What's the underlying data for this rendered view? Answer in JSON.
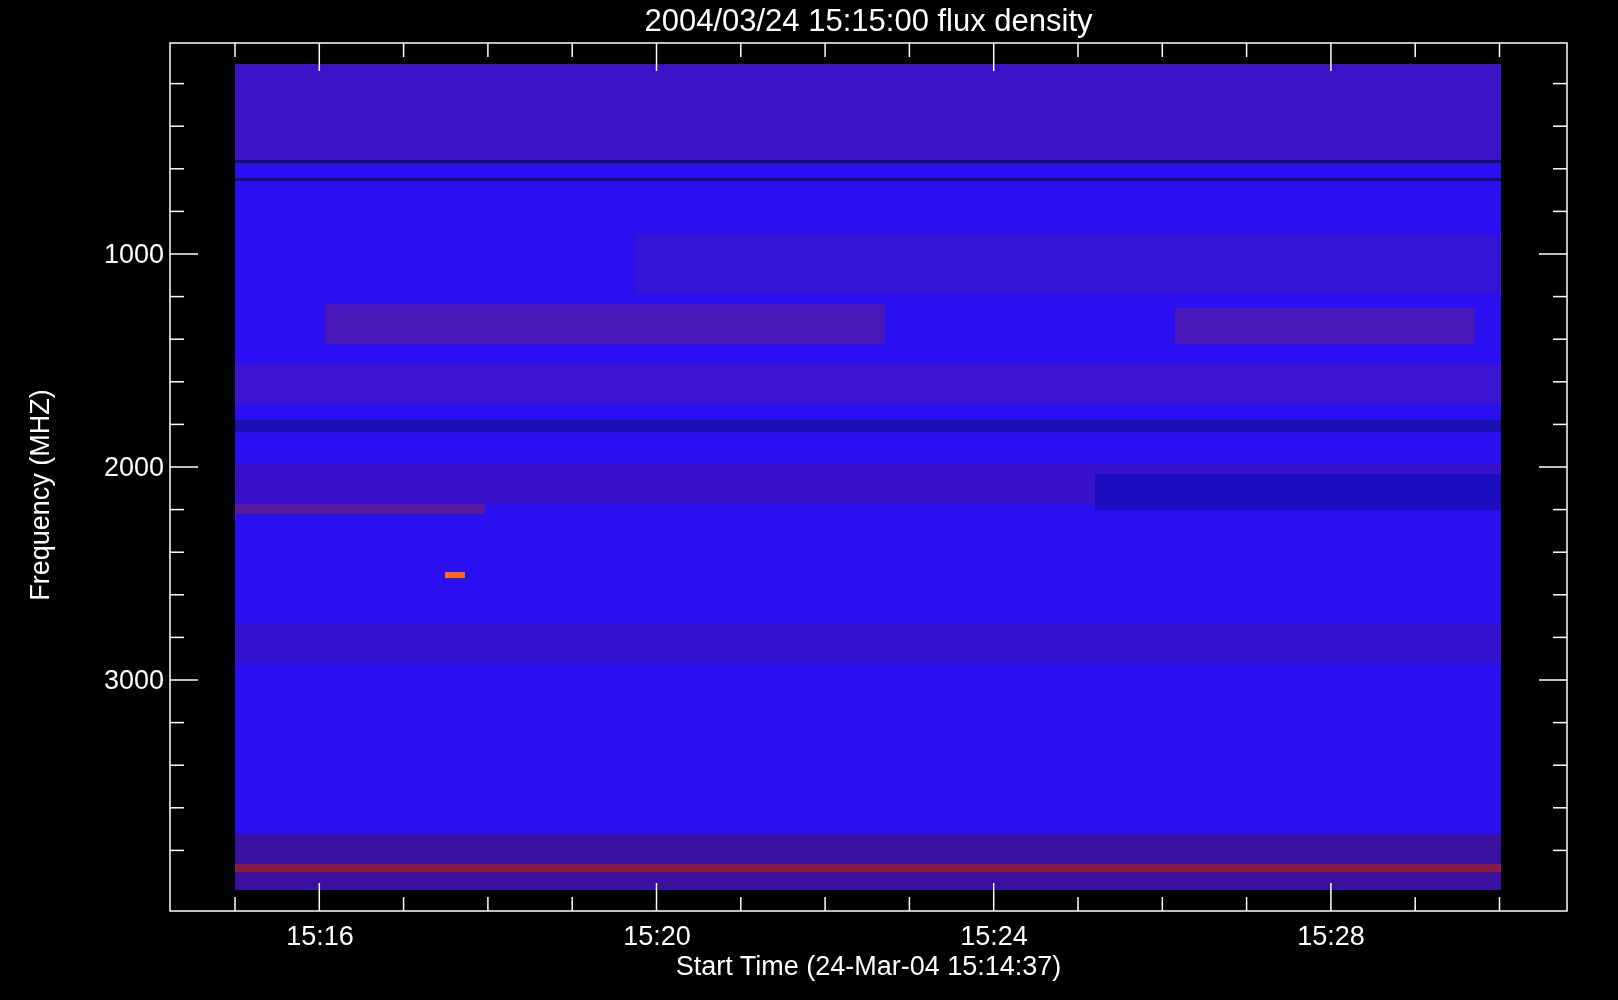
{
  "plot": {
    "title": "2004/03/24 15:15:00 flux density",
    "xlabel": "Start Time (24-Mar-04 15:14:37)",
    "ylabel": "Frequency (MHZ)",
    "xticks": [
      "15:16",
      "15:20",
      "15:24",
      "15:28"
    ],
    "yticks": [
      "1000",
      "2000",
      "3000"
    ]
  }
}
